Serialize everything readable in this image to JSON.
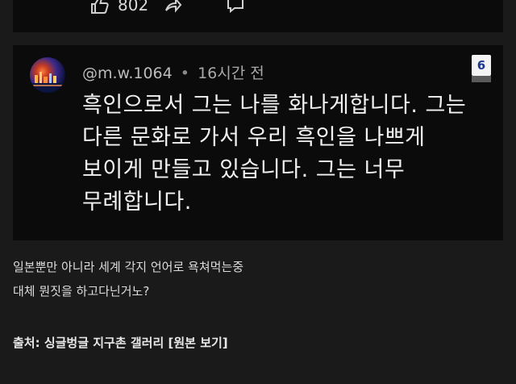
{
  "top_comment": {
    "like_count": "802",
    "icons": [
      "thumbs-up-icon",
      "share-icon",
      "reply-icon"
    ]
  },
  "comment": {
    "avatar": "avatar",
    "username": "@m.w.1064",
    "separator": "•",
    "time": "16시간 전",
    "badge": "6",
    "body_lines": [
      "흑인으로서 그는 나를 화나게합니다. 그는",
      "다른 문화로 가서 우리 흑인을 나쁘게",
      "보이게 만들고 있습니다. 그는 너무",
      "무례합니다."
    ]
  },
  "caption": {
    "line1": "일본뿐만 아니라 세계 각지 언어로 욕쳐먹는중",
    "line2": "대체 뭔짓을 하고다닌거노?"
  },
  "source": {
    "label": "출처: 싱글벙글 지구촌 갤러리",
    "link": "[원본 보기]"
  },
  "colors": {
    "page_bg": "#1a1a1a",
    "card_bg": "#0b0b0b",
    "text": "#f2f2f2",
    "muted": "#a9a9a9",
    "badge_text": "#1b3a8f"
  }
}
